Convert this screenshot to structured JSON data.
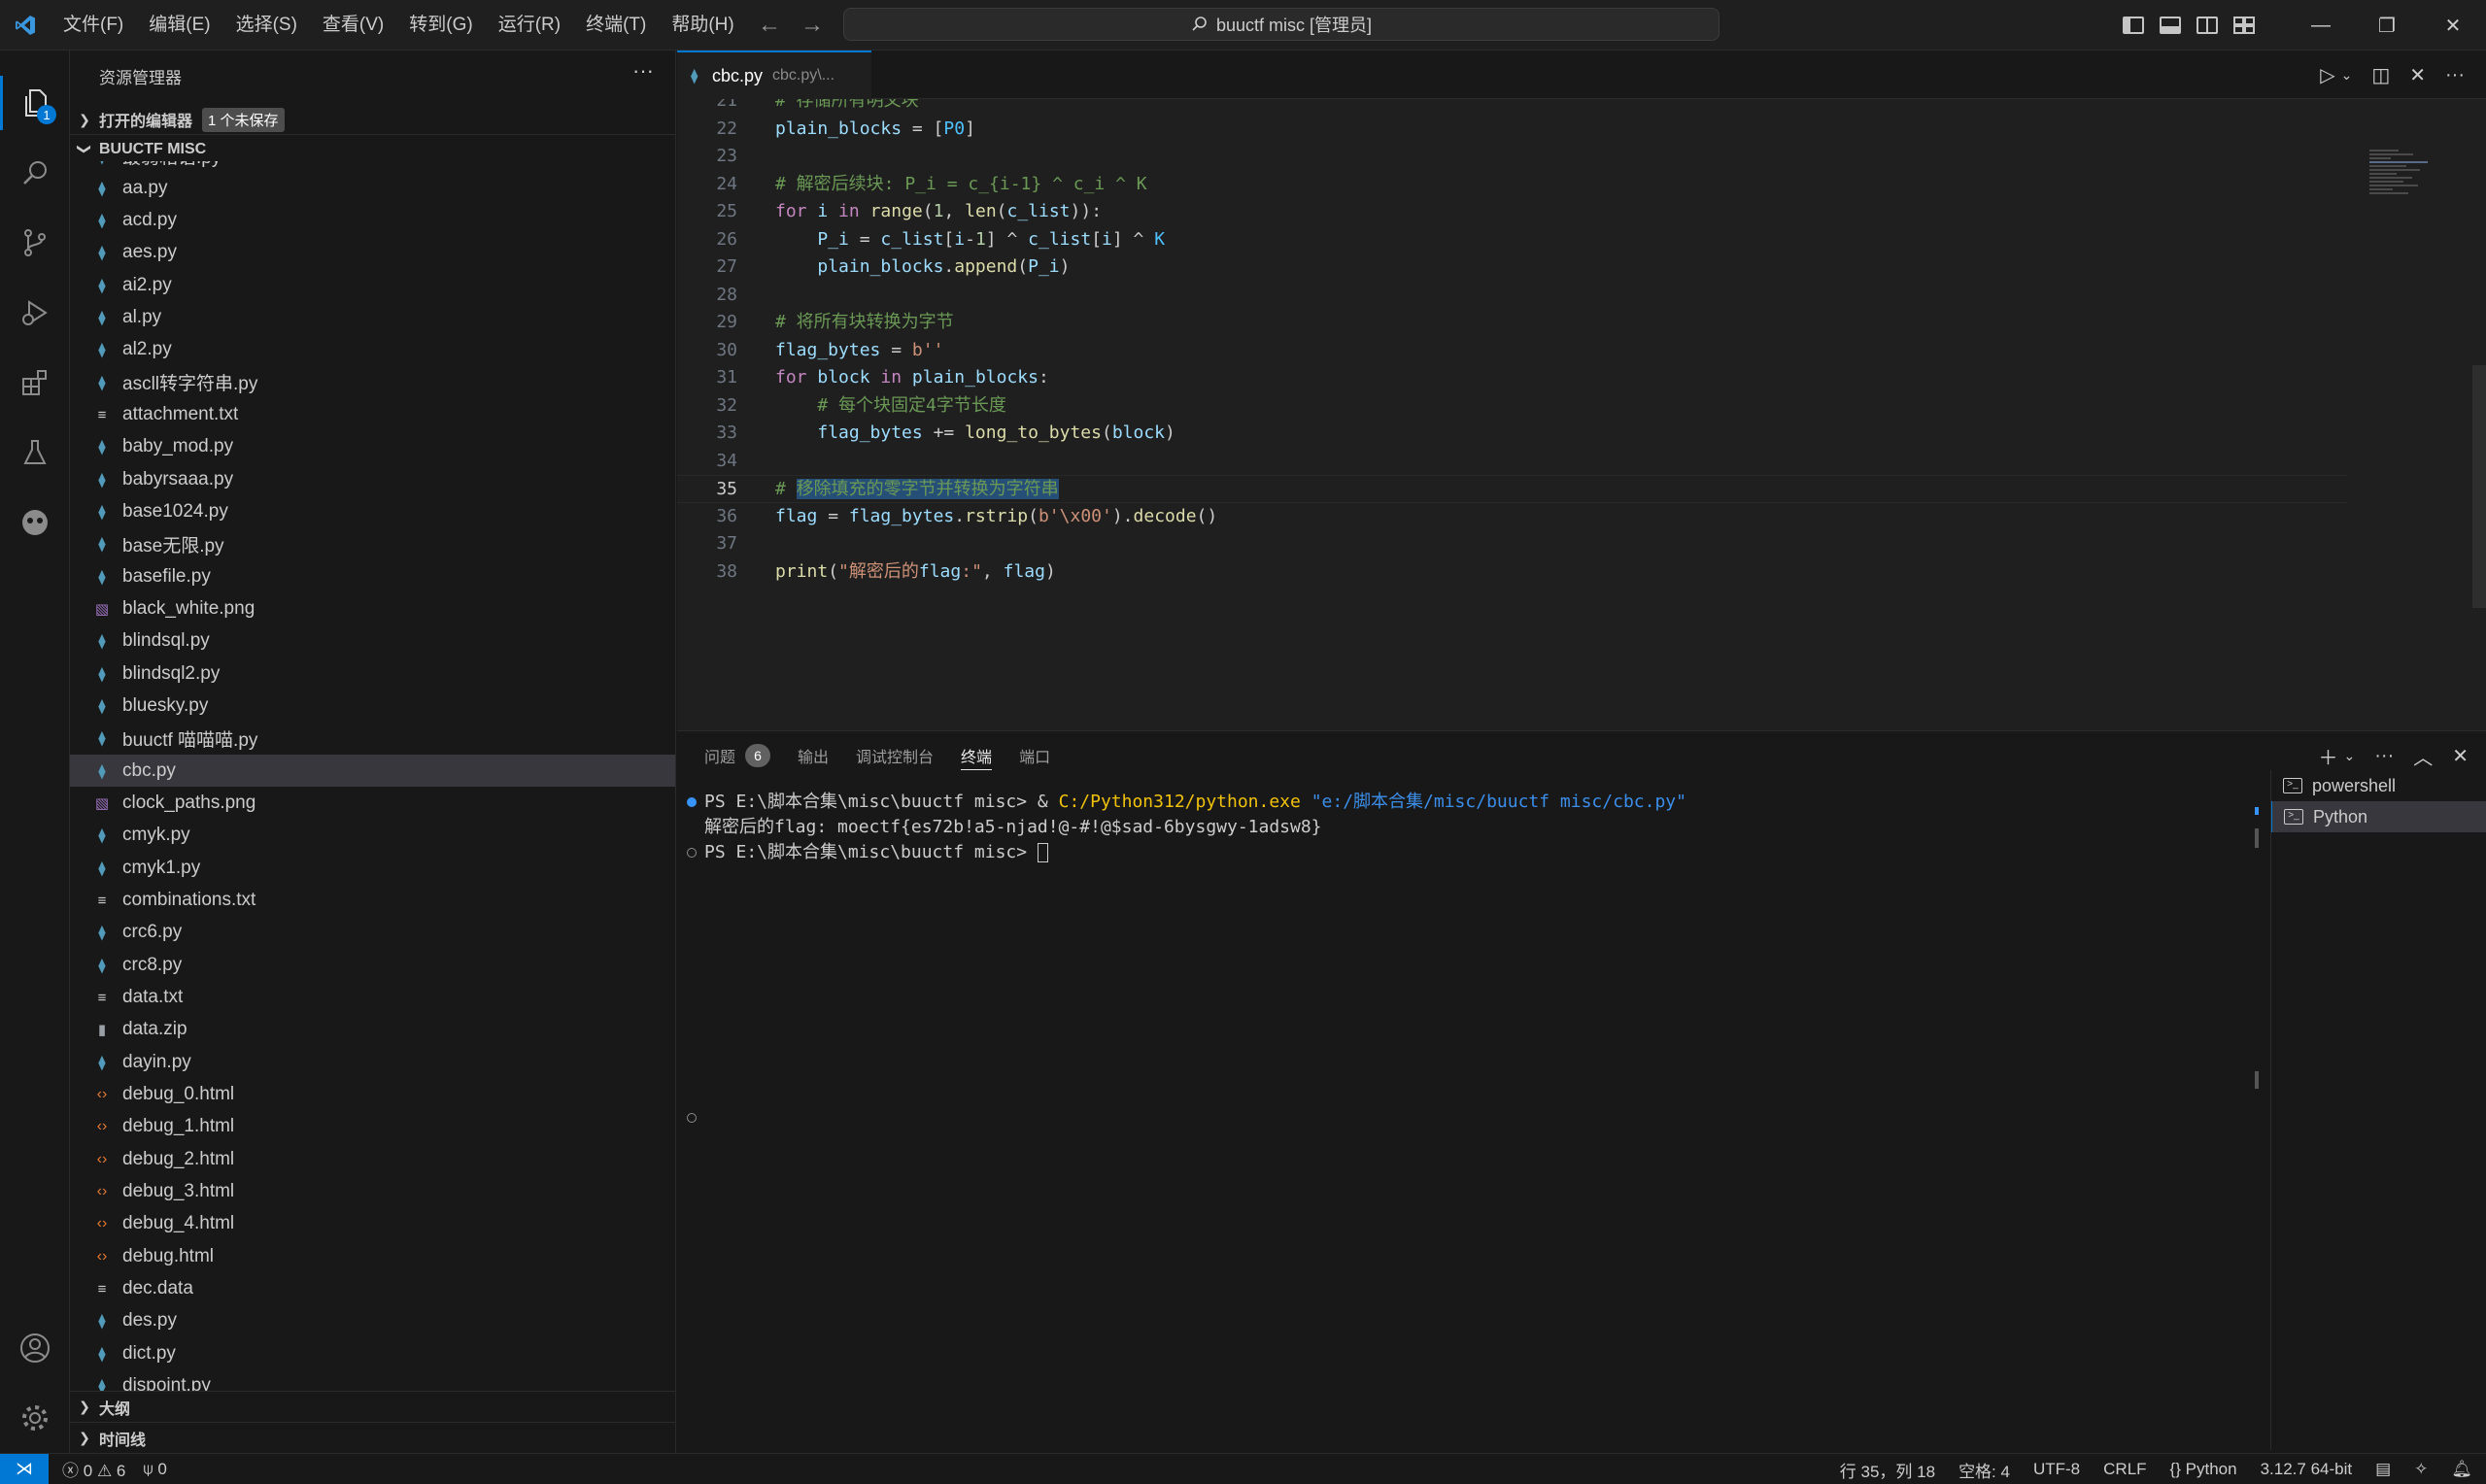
{
  "titlebar": {
    "menu": [
      "文件(F)",
      "编辑(E)",
      "选择(S)",
      "查看(V)",
      "转到(G)",
      "运行(R)",
      "终端(T)",
      "帮助(H)"
    ],
    "search_text": "buuctf misc [管理员]"
  },
  "activity": {
    "explorer_badge": "1"
  },
  "sidebar": {
    "title": "资源管理器",
    "open_editors": "打开的编辑器",
    "unsaved_badge": "1 个未保存",
    "folder": "BUUCTF MISC",
    "files": [
      {
        "name": "最弱箱语.py",
        "type": "py"
      },
      {
        "name": "aa.py",
        "type": "py"
      },
      {
        "name": "acd.py",
        "type": "py"
      },
      {
        "name": "aes.py",
        "type": "py"
      },
      {
        "name": "ai2.py",
        "type": "py"
      },
      {
        "name": "al.py",
        "type": "py"
      },
      {
        "name": "al2.py",
        "type": "py"
      },
      {
        "name": "ascll转字符串.py",
        "type": "py"
      },
      {
        "name": "attachment.txt",
        "type": "txt"
      },
      {
        "name": "baby_mod.py",
        "type": "py"
      },
      {
        "name": "babyrsaaa.py",
        "type": "py"
      },
      {
        "name": "base1024.py",
        "type": "py"
      },
      {
        "name": "base无限.py",
        "type": "py"
      },
      {
        "name": "basefile.py",
        "type": "py"
      },
      {
        "name": "black_white.png",
        "type": "png"
      },
      {
        "name": "blindsql.py",
        "type": "py"
      },
      {
        "name": "blindsql2.py",
        "type": "py"
      },
      {
        "name": "bluesky.py",
        "type": "py"
      },
      {
        "name": "buuctf 喵喵喵.py",
        "type": "py"
      },
      {
        "name": "cbc.py",
        "type": "py"
      },
      {
        "name": "clock_paths.png",
        "type": "png"
      },
      {
        "name": "cmyk.py",
        "type": "py"
      },
      {
        "name": "cmyk1.py",
        "type": "py"
      },
      {
        "name": "combinations.txt",
        "type": "txt"
      },
      {
        "name": "crc6.py",
        "type": "py"
      },
      {
        "name": "crc8.py",
        "type": "py"
      },
      {
        "name": "data.txt",
        "type": "txt"
      },
      {
        "name": "data.zip",
        "type": "zip"
      },
      {
        "name": "dayin.py",
        "type": "py"
      },
      {
        "name": "debug_0.html",
        "type": "html"
      },
      {
        "name": "debug_1.html",
        "type": "html"
      },
      {
        "name": "debug_2.html",
        "type": "html"
      },
      {
        "name": "debug_3.html",
        "type": "html"
      },
      {
        "name": "debug_4.html",
        "type": "html"
      },
      {
        "name": "debug.html",
        "type": "html"
      },
      {
        "name": "dec.data",
        "type": "txt"
      },
      {
        "name": "des.py",
        "type": "py"
      },
      {
        "name": "dict.py",
        "type": "py"
      },
      {
        "name": "dispoint.py",
        "type": "py"
      }
    ],
    "outline": "大纲",
    "timeline": "时间线"
  },
  "editor": {
    "tab_name": "cbc.py",
    "tab_path": "cbc.py\\...",
    "lines": [
      {
        "n": "21",
        "t": "# 存储所有明文块"
      },
      {
        "n": "22",
        "t": "plain_blocks = [P0]"
      },
      {
        "n": "23",
        "t": ""
      },
      {
        "n": "24",
        "t": "# 解密后续块: P_i = c_{i-1} ^ c_i ^ K"
      },
      {
        "n": "25",
        "t": "for i in range(1, len(c_list)):"
      },
      {
        "n": "26",
        "t": "    P_i = c_list[i-1] ^ c_list[i] ^ K"
      },
      {
        "n": "27",
        "t": "    plain_blocks.append(P_i)"
      },
      {
        "n": "28",
        "t": ""
      },
      {
        "n": "29",
        "t": "# 将所有块转换为字节"
      },
      {
        "n": "30",
        "t": "flag_bytes = b''"
      },
      {
        "n": "31",
        "t": "for block in plain_blocks:"
      },
      {
        "n": "32",
        "t": "    # 每个块固定4字节长度"
      },
      {
        "n": "33",
        "t": "    flag_bytes += long_to_bytes(block)"
      },
      {
        "n": "34",
        "t": ""
      },
      {
        "n": "35",
        "t": "# 移除填充的零字节并转换为字符串"
      },
      {
        "n": "36",
        "t": "flag = flag_bytes.rstrip(b'\\x00').decode()"
      },
      {
        "n": "37",
        "t": ""
      },
      {
        "n": "38",
        "t": "print(\"解密后的flag:\", flag)"
      }
    ]
  },
  "panel": {
    "tabs": [
      "问题",
      "输出",
      "调试控制台",
      "终端",
      "端口"
    ],
    "problems_count": "6",
    "terminal": {
      "l1_prompt": "PS E:\\脚本合集\\misc\\buuctf misc> & ",
      "l1_exe": "C:/Python312/python.exe",
      "l1_arg": " \"e:/脚本合集/misc/buuctf misc/cbc.py\"",
      "l2": "解密后的flag: moectf{es72b!a5-njad!@-#!@$sad-6bysgwy-1adsw8}",
      "l3": "PS E:\\脚本合集\\misc\\buuctf misc> "
    },
    "terminals": [
      "powershell",
      "Python"
    ]
  },
  "statusbar": {
    "errors": "0",
    "warnings": "6",
    "ports": "0",
    "position": "行 35，列 18",
    "spaces": "空格: 4",
    "encoding": "UTF-8",
    "eol": "CRLF",
    "language": "Python",
    "interpreter": "3.12.7 64-bit"
  }
}
